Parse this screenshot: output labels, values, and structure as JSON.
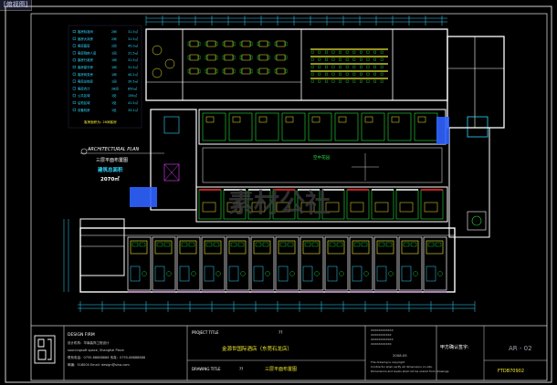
{
  "window": {
    "tab_label": "[俯视图]"
  },
  "legend": {
    "rows": [
      {
        "name": "客房标准间",
        "count": "2间",
        "area": "31.5㎡"
      },
      {
        "name": "客房大床房",
        "count": "2间",
        "area": "31.5㎡"
      },
      {
        "name": "客房套房",
        "count": "2间",
        "area": "45.0㎡"
      },
      {
        "name": "客房残疾人房",
        "count": "1间",
        "area": "31.5㎡"
      },
      {
        "name": "客房行政房",
        "count": "1间",
        "area": "31.5㎡"
      },
      {
        "name": "客房豪华房",
        "count": "1间",
        "area": "31.5㎡"
      },
      {
        "name": "客房商务房",
        "count": "1间",
        "area": "40.2㎡"
      },
      {
        "name": "客房总统房",
        "count": "1间",
        "area": "39.5㎡"
      },
      {
        "name": "客房合计",
        "count": "28间",
        "area": "850㎡"
      },
      {
        "name": "公共区域",
        "count": "1处",
        "area": "156㎡"
      },
      {
        "name": "后勤区域",
        "count": "1处",
        "area": "41.5㎡"
      },
      {
        "name": "设备机房",
        "count": "1处",
        "area": "33.2㎡"
      }
    ],
    "note": "客房面积为: 28间客房"
  },
  "plan_label": {
    "en_title": "ARCHITECTURAL PLAN",
    "cn_title": "三层平面布置图",
    "area_label": "建筑总面积",
    "area_value": "2070㎡"
  },
  "atrium_label": "空中花园",
  "watermark": "素材公社",
  "title_block": {
    "design_firm_label": "DESIGN FIRM",
    "design_firm_lines": [
      "设计机构：华南装饰工程设计",
      "sourcingsoft space, Shanghai Place",
      "联系电话：0755-88888888  传真：0755-88888888",
      "邮编：518000   Email: design@sina.com"
    ],
    "project_title_label": "PROJECT TITLE",
    "project_title": "金源世国际酒店（东莞石龙店）",
    "drawing_title_label": "DRAWING TITLE",
    "drawing_title": "三层平面布置图",
    "placeholder": "??",
    "notes": [
      "XXXXXXXXXXXX",
      "XXXXXXXXXXX",
      "XXXXXXXXXXXX",
      "XXXXXXXXXXX",
      "The drawing is copyright",
      "Contractor shall verify all dimensions on site.",
      "Dimensions and levels shall not be scaled from drawings."
    ],
    "date": "2008.05",
    "client_sign_label": "甲方确认签字:",
    "sheet_no": "AR - 02",
    "drawing_no": "FTDB70902"
  },
  "colors": {
    "wall": "#ffffff",
    "green": "#25e03a",
    "yellow": "#f2ea30",
    "cyan": "#30d8ff",
    "blue": "#2e63ff",
    "magenta": "#e040ff",
    "red": "#ff2a2a",
    "frame": "#cfcfcf"
  }
}
